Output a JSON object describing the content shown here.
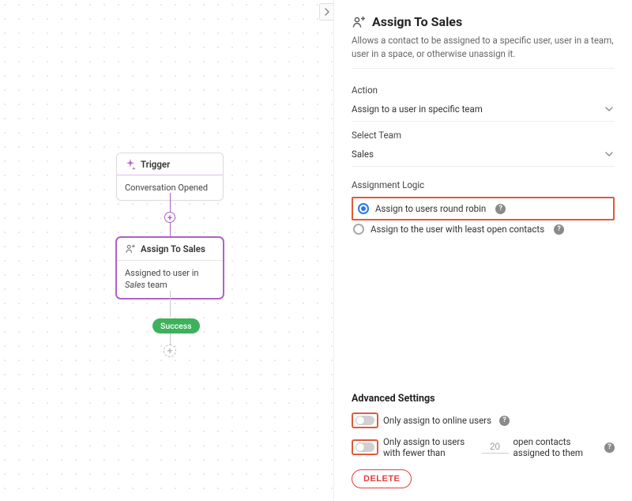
{
  "flow": {
    "trigger": {
      "title": "Trigger",
      "body": "Conversation Opened"
    },
    "assign": {
      "title": "Assign To Sales",
      "body_prefix": "Assigned to user in ",
      "body_em": "Sales",
      "body_suffix": " team"
    },
    "success_label": "Success"
  },
  "panel": {
    "title": "Assign To Sales",
    "description": "Allows a contact to be assigned to a specific user, user in a team, user in a space, or otherwise unassign it.",
    "action": {
      "label": "Action",
      "value": "Assign to a user in specific team"
    },
    "team": {
      "label": "Select Team",
      "value": "Sales"
    },
    "logic": {
      "label": "Assignment Logic",
      "option1": "Assign to users round robin",
      "option2": "Assign to the user with least open contacts"
    },
    "advanced": {
      "title": "Advanced Settings",
      "row1": "Only assign to online users",
      "row2_a": "Only assign to users with fewer than",
      "row2_value": "20",
      "row2_b": "open contacts assigned to them"
    },
    "delete_label": "DELETE"
  }
}
